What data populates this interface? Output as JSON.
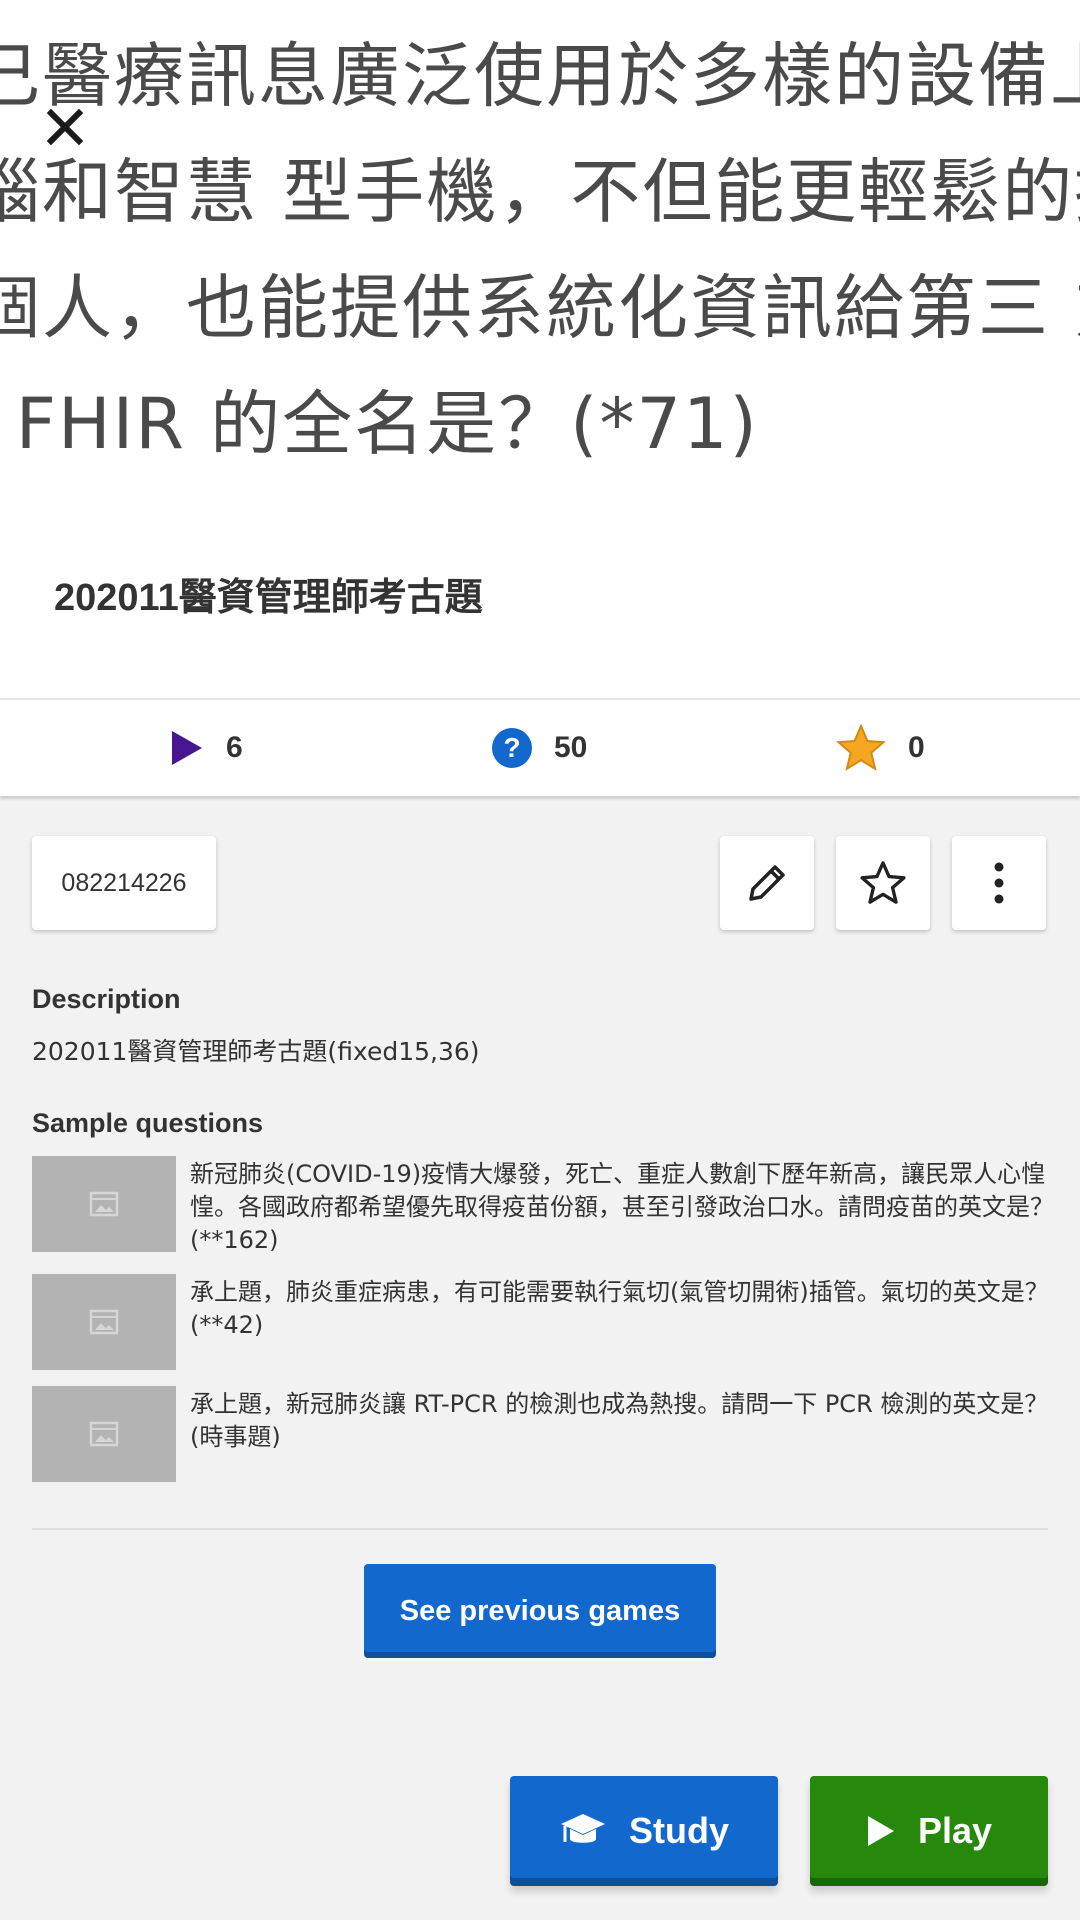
{
  "hero": {
    "lines": [
      "己醫療訊息廣泛使用於多樣的設備上",
      "腦和智慧 型手機，不但能更輕鬆的提供",
      "個人，也能提供系統化資訊給第三 方",
      "l FHIR 的全名是？(*71)"
    ]
  },
  "title": "202011醫資管理師考古題",
  "stats": {
    "plays": "6",
    "questions": "50",
    "favorites": "0"
  },
  "kahoot_id": "082214226",
  "description": {
    "label": "Description",
    "text": "202011醫資管理師考古題(fixed15,36)"
  },
  "sample": {
    "label": "Sample questions",
    "questions": [
      {
        "text": "新冠肺炎(COVID-19)疫情大爆發，死亡、重症人數創下歷年新高，讓民眾人心惶惶。各國政府都希望優先取得疫苗份額，甚至引發政治口水。請問疫苗的英文是？(**162)"
      },
      {
        "text": "承上題，肺炎重症病患，有可能需要執行氣切(氣管切開術)插管。氣切的英文是？(**42)"
      },
      {
        "text": "承上題，新冠肺炎讓 RT-PCR 的檢測也成為熱搜。請問一下 PCR 檢測的英文是？(時事題)"
      }
    ]
  },
  "buttons": {
    "previous_games": "See previous games",
    "study": "Study",
    "play": "Play"
  },
  "colors": {
    "blue": "#1368ce",
    "green": "#26890c",
    "purple": "#46178f",
    "star": "#f5a623"
  },
  "icons": [
    "close-icon",
    "play-icon",
    "question-icon",
    "star-icon",
    "pencil-icon",
    "star-outline-icon",
    "more-vertical-icon",
    "image-placeholder-icon",
    "graduation-cap-icon"
  ]
}
